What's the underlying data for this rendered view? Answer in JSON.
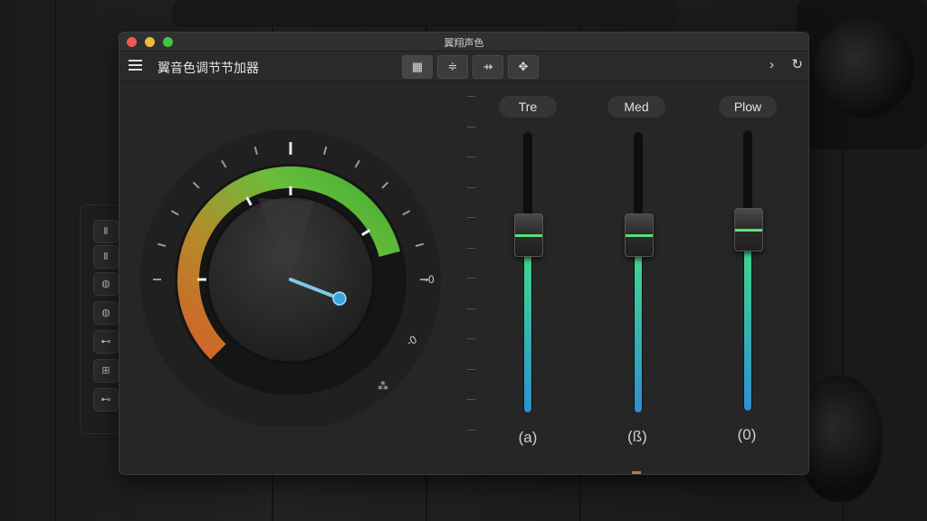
{
  "window": {
    "title": "翼翔声色",
    "app_title": "翼音色调节节加器",
    "toolbar": {
      "buttons": [
        {
          "name": "layout-view-button",
          "glyph": "▦"
        },
        {
          "name": "split-button",
          "glyph": "≑"
        },
        {
          "name": "arrows-button",
          "glyph": "⇸"
        },
        {
          "name": "move-button",
          "glyph": "✥"
        }
      ],
      "next_glyph": "›",
      "refresh_glyph": "↻"
    }
  },
  "side_panel": {
    "buttons": [
      "Ⅱ",
      "Ⅱ",
      "◍",
      "◍",
      "⊷",
      "⊞",
      "⊷"
    ]
  },
  "knob": {
    "side_labels": [
      "-0",
      "-0",
      "⁂"
    ],
    "gauge_level": 0.72
  },
  "sliders": [
    {
      "label": "Tre",
      "value_text": "(a)",
      "level": 0.58
    },
    {
      "label": "Med",
      "value_text": "(ß)",
      "level": 0.58
    },
    {
      "label": "Plow",
      "value_text": "(0)",
      "level": 0.6
    }
  ],
  "colors": {
    "accent_green": "#57e07a",
    "accent_blue": "#3a9bd6",
    "gauge_orange": "#d2622a"
  }
}
